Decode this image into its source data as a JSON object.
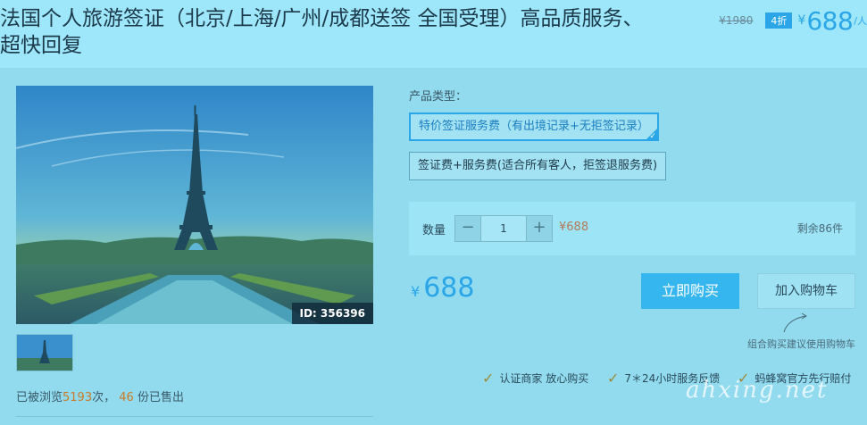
{
  "product": {
    "title": "法国个人旅游签证（北京/上海/广州/成都送签 全国受理）高品质服务、超快回复"
  },
  "pricing": {
    "old_price": "¥1980",
    "discount": "4折",
    "currency": "¥",
    "price": "688",
    "unit": "/人"
  },
  "image": {
    "id_label": "ID: 356396"
  },
  "stats": {
    "views_prefix": "已被浏览",
    "views": "5193",
    "views_suffix": "次，",
    "sold": "46",
    "sold_suffix": "份已售出"
  },
  "options": {
    "label": "产品类型：",
    "items": [
      {
        "label": "特价签证服务费（有出境记录+无拒签记录）",
        "selected": true
      },
      {
        "label": "签证费+服务费(适合所有客人，拒签退服务费)",
        "selected": false
      }
    ]
  },
  "quantity": {
    "label": "数量",
    "minus": "−",
    "value": "1",
    "plus": "+",
    "line_price": "¥688",
    "stock": "剩余86件"
  },
  "total": {
    "currency": "¥",
    "value": "688"
  },
  "actions": {
    "buy_now": "立即购买",
    "add_to_cart": "加入购物车",
    "cart_hint": "组合购买建议使用购物车"
  },
  "guarantees": [
    {
      "icon": "check-icon",
      "label": "认证商家 放心购买"
    },
    {
      "icon": "check-icon",
      "label": "7＊24小时服务反馈"
    },
    {
      "icon": "check-icon",
      "label": "蚂蜂窝官方先行赔付"
    }
  ],
  "watermark": "ahxing.net",
  "colors": {
    "accent": "#2aa6e8",
    "page_bg": "#92dbef",
    "header_bg": "#9ee6fa"
  }
}
